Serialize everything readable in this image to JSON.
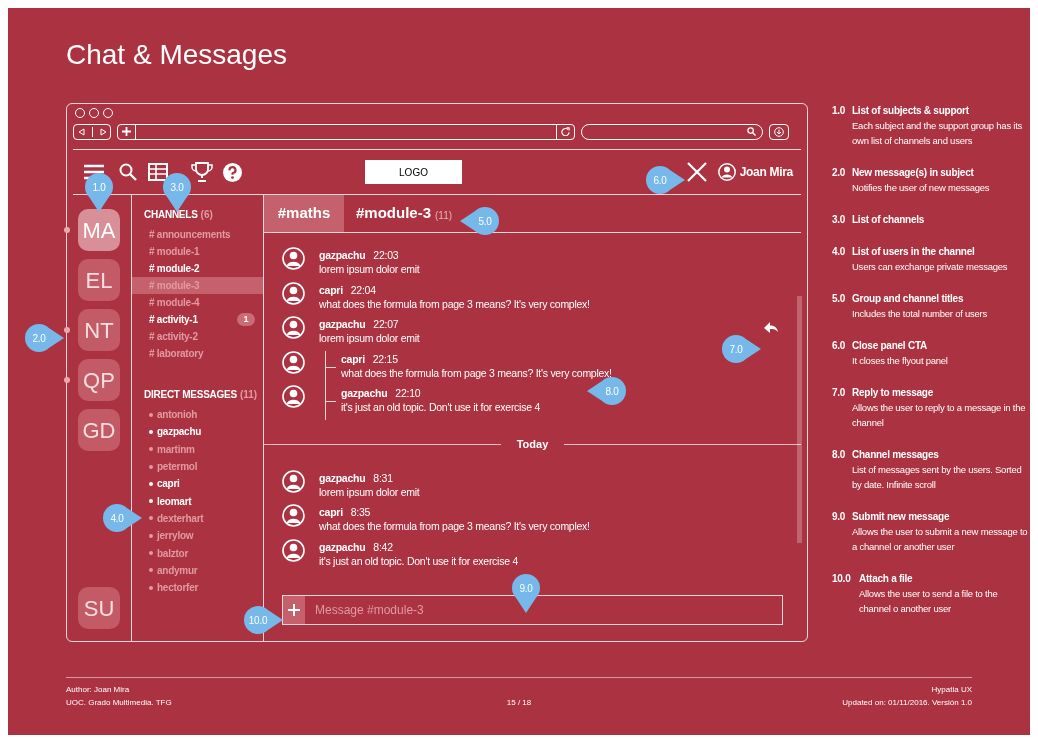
{
  "title": "Chat & Messages",
  "app_header": {
    "logo": "LOGO",
    "user": "Joan Mira"
  },
  "subjects": [
    {
      "label": "MA",
      "selected": true,
      "new_messages": true
    },
    {
      "label": "EL",
      "selected": false,
      "new_messages": false
    },
    {
      "label": "NT",
      "selected": false,
      "new_messages": true
    },
    {
      "label": "QP",
      "selected": false,
      "new_messages": true
    },
    {
      "label": "GD",
      "selected": false,
      "new_messages": false
    }
  ],
  "support": {
    "label": "SU",
    "selected": false
  },
  "channels": {
    "heading": "CHANNELS",
    "count": "(6)",
    "items": [
      {
        "name": "# announcements",
        "unread": false,
        "selected": false
      },
      {
        "name": "# module-1",
        "unread": false,
        "selected": false
      },
      {
        "name": "# module-2",
        "unread": true,
        "selected": false
      },
      {
        "name": "# module-3",
        "unread": false,
        "selected": true
      },
      {
        "name": "# module-4",
        "unread": false,
        "selected": false
      },
      {
        "name": "# activity-1",
        "unread": true,
        "selected": false,
        "badge": "1"
      },
      {
        "name": "# activity-2",
        "unread": false,
        "selected": false
      },
      {
        "name": "# laboratory",
        "unread": false,
        "selected": false
      }
    ]
  },
  "direct_messages": {
    "heading": "DIRECT MESSAGES",
    "count": "(11)",
    "users": [
      {
        "name": "antonioh",
        "online": false
      },
      {
        "name": "gazpachu",
        "online": true
      },
      {
        "name": "martinm",
        "online": false
      },
      {
        "name": "petermol",
        "online": false
      },
      {
        "name": "capri",
        "online": true
      },
      {
        "name": "leomart",
        "online": true
      },
      {
        "name": "dexterhart",
        "online": false
      },
      {
        "name": "jerrylow",
        "online": false
      },
      {
        "name": "balztor",
        "online": false
      },
      {
        "name": "andymur",
        "online": false
      },
      {
        "name": "hectorfer",
        "online": false
      }
    ]
  },
  "chat": {
    "group_title": "#maths",
    "channel_title": "#module-3",
    "member_count": "(11)",
    "messages": [
      {
        "kind": "message",
        "user": "gazpachu",
        "time": "22:03",
        "text": "lorem ipsum dolor emit",
        "hovered": false
      },
      {
        "kind": "message",
        "user": "capri",
        "time": "22:04",
        "text": "what does the formula from page 3 means? It's very complex!",
        "hovered": false
      },
      {
        "kind": "message",
        "user": "gazpachu",
        "time": "22:07",
        "text": "lorem ipsum dolor emit",
        "hovered": true
      },
      {
        "kind": "reply",
        "user": "capri",
        "time": "22:15",
        "text": "what does the formula from page 3 means? It's very complex!",
        "hovered": false
      },
      {
        "kind": "reply",
        "user": "gazpachu",
        "time": "22:10",
        "text": "it's just an old topic. Don't use it for exercise 4",
        "hovered": false
      },
      {
        "kind": "separator",
        "text": "Today"
      },
      {
        "kind": "message",
        "user": "gazpachu",
        "time": "8:31",
        "text": "lorem ipsum dolor emit",
        "hovered": false
      },
      {
        "kind": "message",
        "user": "capri",
        "time": "8:35",
        "text": "what does the formula from page 3 means? It's very complex!",
        "hovered": false
      },
      {
        "kind": "message",
        "user": "gazpachu",
        "time": "8:42",
        "text": "it's just an old topic. Don't use it for exercise 4",
        "hovered": false
      }
    ],
    "composer": {
      "placeholder": "Message #module-3"
    }
  },
  "callouts": [
    {
      "label": "1.0"
    },
    {
      "label": "3.0"
    },
    {
      "label": "6.0"
    },
    {
      "label": "5.0"
    },
    {
      "label": "2.0"
    },
    {
      "label": "7.0"
    },
    {
      "label": "8.0"
    },
    {
      "label": "4.0"
    },
    {
      "label": "9.0"
    },
    {
      "label": "10.0"
    }
  ],
  "legend": [
    {
      "number": "1.0",
      "title": "List of subjects & support",
      "description": "Each subject and the support group has its own list of channels and users"
    },
    {
      "number": "2.0",
      "title": "New message(s) in subject",
      "description": "Notifies the user of new messages"
    },
    {
      "number": "3.0",
      "title": "List of channels"
    },
    {
      "number": "4.0",
      "title": "List of users in the channel",
      "description": "Users can exchange private messages"
    },
    {
      "number": "5.0",
      "title": "Group and channel titles",
      "description": "Includes the total number of users"
    },
    {
      "number": "6.0",
      "title": "Close panel CTA",
      "description": "It closes the flyout panel"
    },
    {
      "number": "7.0",
      "title": "Reply to message",
      "description": "Allows the user to reply to a message in the channel"
    },
    {
      "number": "8.0",
      "title": "Channel messages",
      "description": "List of messages sent by the users. Sorted by date. Infinite scroll"
    },
    {
      "number": "9.0",
      "title": "Submit new message",
      "description": "Allows the user to submit a new message to a channel or another user"
    },
    {
      "number": "10.0",
      "title": "Attach a file",
      "description": "Allows the user to send a file to the channel o another user"
    }
  ],
  "footer": {
    "author": "Author: Joan Mira",
    "course": "UOC. Grado Multimedia. TFG",
    "page": "15 / 18",
    "project": "Hypatia UX",
    "updated": "Updated on: 01/11/2016. Versión 1.0"
  }
}
